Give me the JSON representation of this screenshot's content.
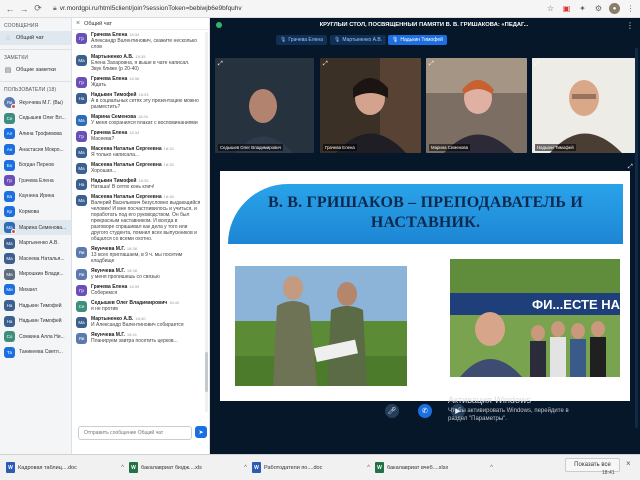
{
  "browser": {
    "url": "vr.mordgpi.ru/html5client/join?sessionToken=bebiwjb6e9bfquhv"
  },
  "sidebar": {
    "messages_title": "СООБЩЕНИЯ",
    "public_chat": "Общий чат",
    "notes_title": "ЗАМЕТКИ",
    "shared_notes": "Общие заметки",
    "users_title": "ПОЛЬЗОВАТЕЛИ (18)",
    "users": [
      {
        "initials": "Яи",
        "name": "Якунчева М.Г. (Вы)",
        "color": "#5b7bb0"
      },
      {
        "initials": "Се",
        "name": "Седышев Олег Вл...",
        "color": "#3e8e7e"
      },
      {
        "initials": "Ал",
        "name": "Алина Трофимова",
        "color": "#1b6fe0"
      },
      {
        "initials": "Ан",
        "name": "Анастасия Мокро...",
        "color": "#1b6fe0"
      },
      {
        "initials": "Бо",
        "name": "Богдан Пернов",
        "color": "#1b6fe0"
      },
      {
        "initials": "Гр",
        "name": "Грачева Елена",
        "color": "#6b4fb8"
      },
      {
        "initials": "Ка",
        "name": "Каунина Ирина",
        "color": "#1b6fe0"
      },
      {
        "initials": "Кр",
        "name": "Кормова",
        "color": "#1b6fe0"
      },
      {
        "initials": "Ма",
        "name": "Марина Семенова...",
        "color": "#2e6cb7"
      },
      {
        "initials": "Ма",
        "name": "Мартыненко А.В.",
        "color": "#3b5f8f"
      },
      {
        "initials": "Ма",
        "name": "Масеева Наталья...",
        "color": "#3b5f8f"
      },
      {
        "initials": "Ми",
        "name": "Мирошкин Влади...",
        "color": "#5d6d7e"
      },
      {
        "initials": "Ми",
        "name": "Михаил",
        "color": "#1b6fe0"
      },
      {
        "initials": "На",
        "name": "Надькин Тимофей",
        "color": "#3b5f8f"
      },
      {
        "initials": "На",
        "name": "Надькин Тимофей",
        "color": "#3b5f8f"
      },
      {
        "initials": "Со",
        "name": "Сомкина Алла Ни...",
        "color": "#3e8e7e"
      },
      {
        "initials": "Та",
        "name": "Таникеева Светл...",
        "color": "#1b6fe0"
      }
    ]
  },
  "chat": {
    "title": "Общий чат",
    "close_icon": "close-icon",
    "input_placeholder": "Отправить сообщение Общий чат",
    "messages": [
      {
        "initials": "Гр",
        "color": "#6b4fb8",
        "name": "Грачева Елена",
        "time": "18:34",
        "text": "Александр Валентинович, скажите несколько слов"
      },
      {
        "initials": "Ма",
        "color": "#3b5f8f",
        "name": "Мартыненко А.В.",
        "time": "18:35",
        "text": "Елена Захаровна, я выше в чате написал. Звук ближе (р 20-40)"
      },
      {
        "initials": "Гр",
        "color": "#6b4fb8",
        "name": "Грачева Елена",
        "time": "18:36",
        "text": "Ждать"
      },
      {
        "initials": "На",
        "color": "#3b5f8f",
        "name": "Надькин Тимофей",
        "time": "18:33",
        "text": "А в социальных сетях эту презентацию можно разместить?"
      },
      {
        "initials": "Ма",
        "color": "#2e6cb7",
        "name": "Марина Семенова",
        "time": "18:34",
        "text": "У меня сохранился плакат с воспоминаниями"
      },
      {
        "initials": "Гр",
        "color": "#6b4fb8",
        "name": "Грачева Елена",
        "time": "18:34",
        "text": "Масеева?"
      },
      {
        "initials": "Ма",
        "color": "#3b5f8f",
        "name": "Масеева Наталья Сергеевна",
        "time": "18:34",
        "text": "Я только написала..."
      },
      {
        "initials": "Ма",
        "color": "#3b5f8f",
        "name": "Масеева Наталья Сергеевна",
        "time": "18:35",
        "text": "Хорошая..."
      },
      {
        "initials": "На",
        "color": "#3b5f8f",
        "name": "Надькин Тимофей",
        "time": "18:35",
        "text": "Наташа! В сетях конь клич!"
      },
      {
        "initials": "Ма",
        "color": "#3b5f8f",
        "name": "Масеева Наталья Сергеевна",
        "time": "18:36",
        "text": "Валерий Васильевич безусловно выдающийся человек! И мне посчастливилось и учиться, и поработать под его руководством. Он был прекрасным наставником. И всегда в разговоре спрашивал как дела у того или другого студента, помнил всех выпускников и общался со всеми охотно."
      },
      {
        "initials": "Яи",
        "color": "#5b7bb0",
        "name": "Якунчева М.Г.",
        "time": "18:38",
        "text": "13 всех приглашаем, в 9 ч. мы посетим кладбище"
      },
      {
        "initials": "Яи",
        "color": "#5b7bb0",
        "name": "Якунчева М.Г.",
        "time": "18:38",
        "text": "у меня пропишешь со связью"
      },
      {
        "initials": "Гр",
        "color": "#6b4fb8",
        "name": "Грачева Елена",
        "time": "18:39",
        "text": "Соберемся"
      },
      {
        "initials": "Се",
        "color": "#3e8e7e",
        "name": "Седышев Олег Владимирович",
        "time": "18:40",
        "text": "я не против"
      },
      {
        "initials": "Ма",
        "color": "#3b5f8f",
        "name": "Мартыненко А.В.",
        "time": "18:40",
        "text": "И Александр Валентинович собирается"
      },
      {
        "initials": "Яи",
        "color": "#5b7bb0",
        "name": "Якунчева М.Г.",
        "time": "18:41",
        "text": "Планируем завтра посетить церков..."
      }
    ]
  },
  "meeting": {
    "title": "КРУГЛЫЙ СТОЛ, ПОСВЯЩЕННЫЙ ПАМЯТИ В. В. ГРИШАКОВА: «ПЕДАГ...",
    "talkers": [
      "Грачева Елена",
      "Мартыненко А.В.",
      "Надькин Тимофей"
    ],
    "videos": [
      {
        "name": "Седышев Олег Владимирович"
      },
      {
        "name": "Грачева Елена"
      },
      {
        "name": "Марина Семенова"
      },
      {
        "name": "Надькин Тимофей"
      }
    ],
    "slide_title": "В. В. ГРИШАКОВ – ПРЕПОДАВАТЕЛЬ И НАСТАВНИК.",
    "photo_banner_text": "ФИ...ЕСТЕ НА"
  },
  "windows_watermark": {
    "line1": "Активация Windows",
    "line2": "Чтобы активировать Windows, перейдите в",
    "line3": "раздел \"Параметры\"."
  },
  "downloads": [
    {
      "type": "W",
      "name": "Кадровая таблиц....doc"
    },
    {
      "type": "W",
      "name": "бакалавриат бюдж....xls"
    },
    {
      "type": "W",
      "name": "Работодатели по....doc"
    },
    {
      "type": "W",
      "name": "бакалавриат вчеб....xlsx"
    }
  ],
  "downloads_show_all": "Показать все",
  "clock": "18:41"
}
